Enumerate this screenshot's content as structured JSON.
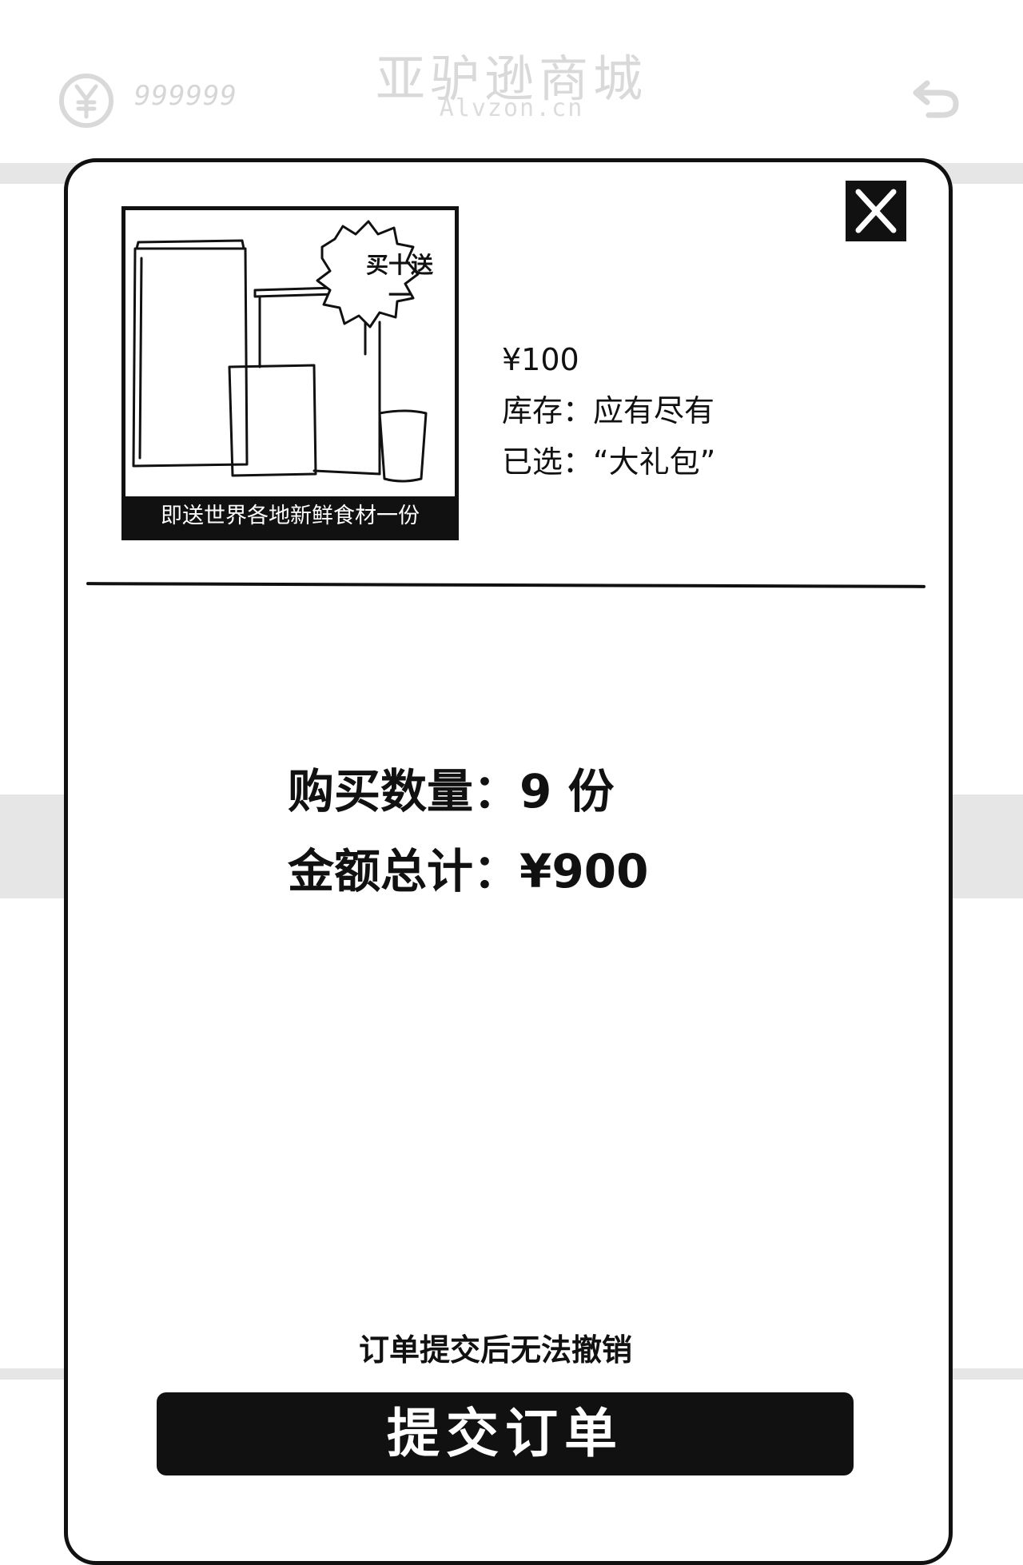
{
  "header": {
    "coin_icon": "yen-coin-icon",
    "coin_balance": "999999",
    "store_title": "亚驴逊商城",
    "store_domain": "Alvzon.cn",
    "back_icon": "back-arrow-icon"
  },
  "modal": {
    "close_icon": "close-x-icon",
    "product": {
      "promo_badge": "买十送一",
      "caption": "即送世界各地新鲜食材一份",
      "price": "¥100",
      "stock": "库存：应有尽有",
      "selected": "已选：“大礼包”"
    },
    "summary": {
      "quantity": "购买数量：9 份",
      "total": "金额总计：¥900"
    },
    "warning": "订单提交后无法撤销",
    "submit_label": "提交订单"
  },
  "colors": {
    "ink": "#111111",
    "background": "#ffffff",
    "faded_background": "#e6e6e6"
  }
}
